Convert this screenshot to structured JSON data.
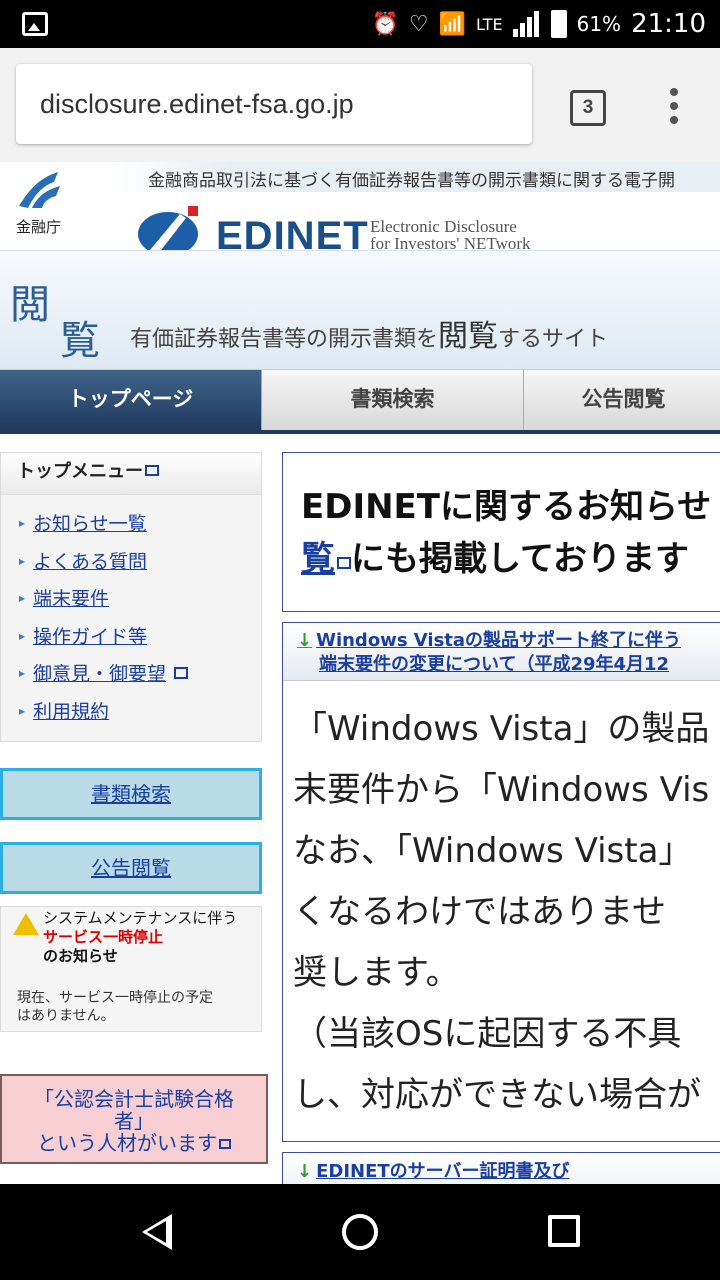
{
  "status_bar": {
    "battery": "61%",
    "time": "21:10",
    "network": "LTE"
  },
  "browser": {
    "url": "disclosure.edinet-fsa.go.jp",
    "tab_count": "3"
  },
  "header": {
    "tagline": "金融商品取引法に基づく有価証券報告書等の開示書類に関する電子開",
    "fsa_name": "金融庁",
    "edinet_title": "EDINET",
    "edinet_sub_line1": "Electronic Disclosure",
    "edinet_sub_line2": "for Investors' NETwork",
    "banner_kanji1": "閲",
    "banner_kanji2": "覧",
    "banner_text_a": "有価証券報告書等の開示書類を",
    "banner_text_b": "閲覧",
    "banner_text_c": "するサイト"
  },
  "nav_tabs": [
    "トップページ",
    "書類検索",
    "公告閲覧"
  ],
  "sidebar": {
    "menu_title": "トップメニュー",
    "items": [
      "お知らせ一覧",
      "よくある質問",
      "端末要件",
      "操作ガイド等",
      "御意見・御要望",
      "利用規約"
    ],
    "btn_search": "書類検索",
    "btn_notice": "公告閲覧",
    "maint_line1": "システムメンテナンスに伴う",
    "maint_line2": "サービス一時停止",
    "maint_line3": "のお知らせ",
    "maint_body1": "現在、サービス一時停止の予定",
    "maint_body2": "はありません。",
    "promo_line1": "「公認会計士試験合格",
    "promo_line2": "者」",
    "promo_line3": "という人材がいます"
  },
  "main": {
    "notice_line1": "EDINETに関するお知らせ",
    "notice_link": "覧",
    "notice_line2": "にも掲載しております",
    "article_title1": "Windows Vistaの製品サポート終了に伴う",
    "article_title2": "端末要件の変更について（平成29年4月12",
    "article_lines": [
      "「Windows Vista」の製品",
      "末要件から「Windows Vis",
      "なお、「Windows Vista」",
      "くなるわけではありませ",
      "奨します。",
      "（当該OSに起因する不具",
      "し、対応ができない場合が"
    ],
    "article2_title": "EDINETのサーバー証明書及び"
  }
}
